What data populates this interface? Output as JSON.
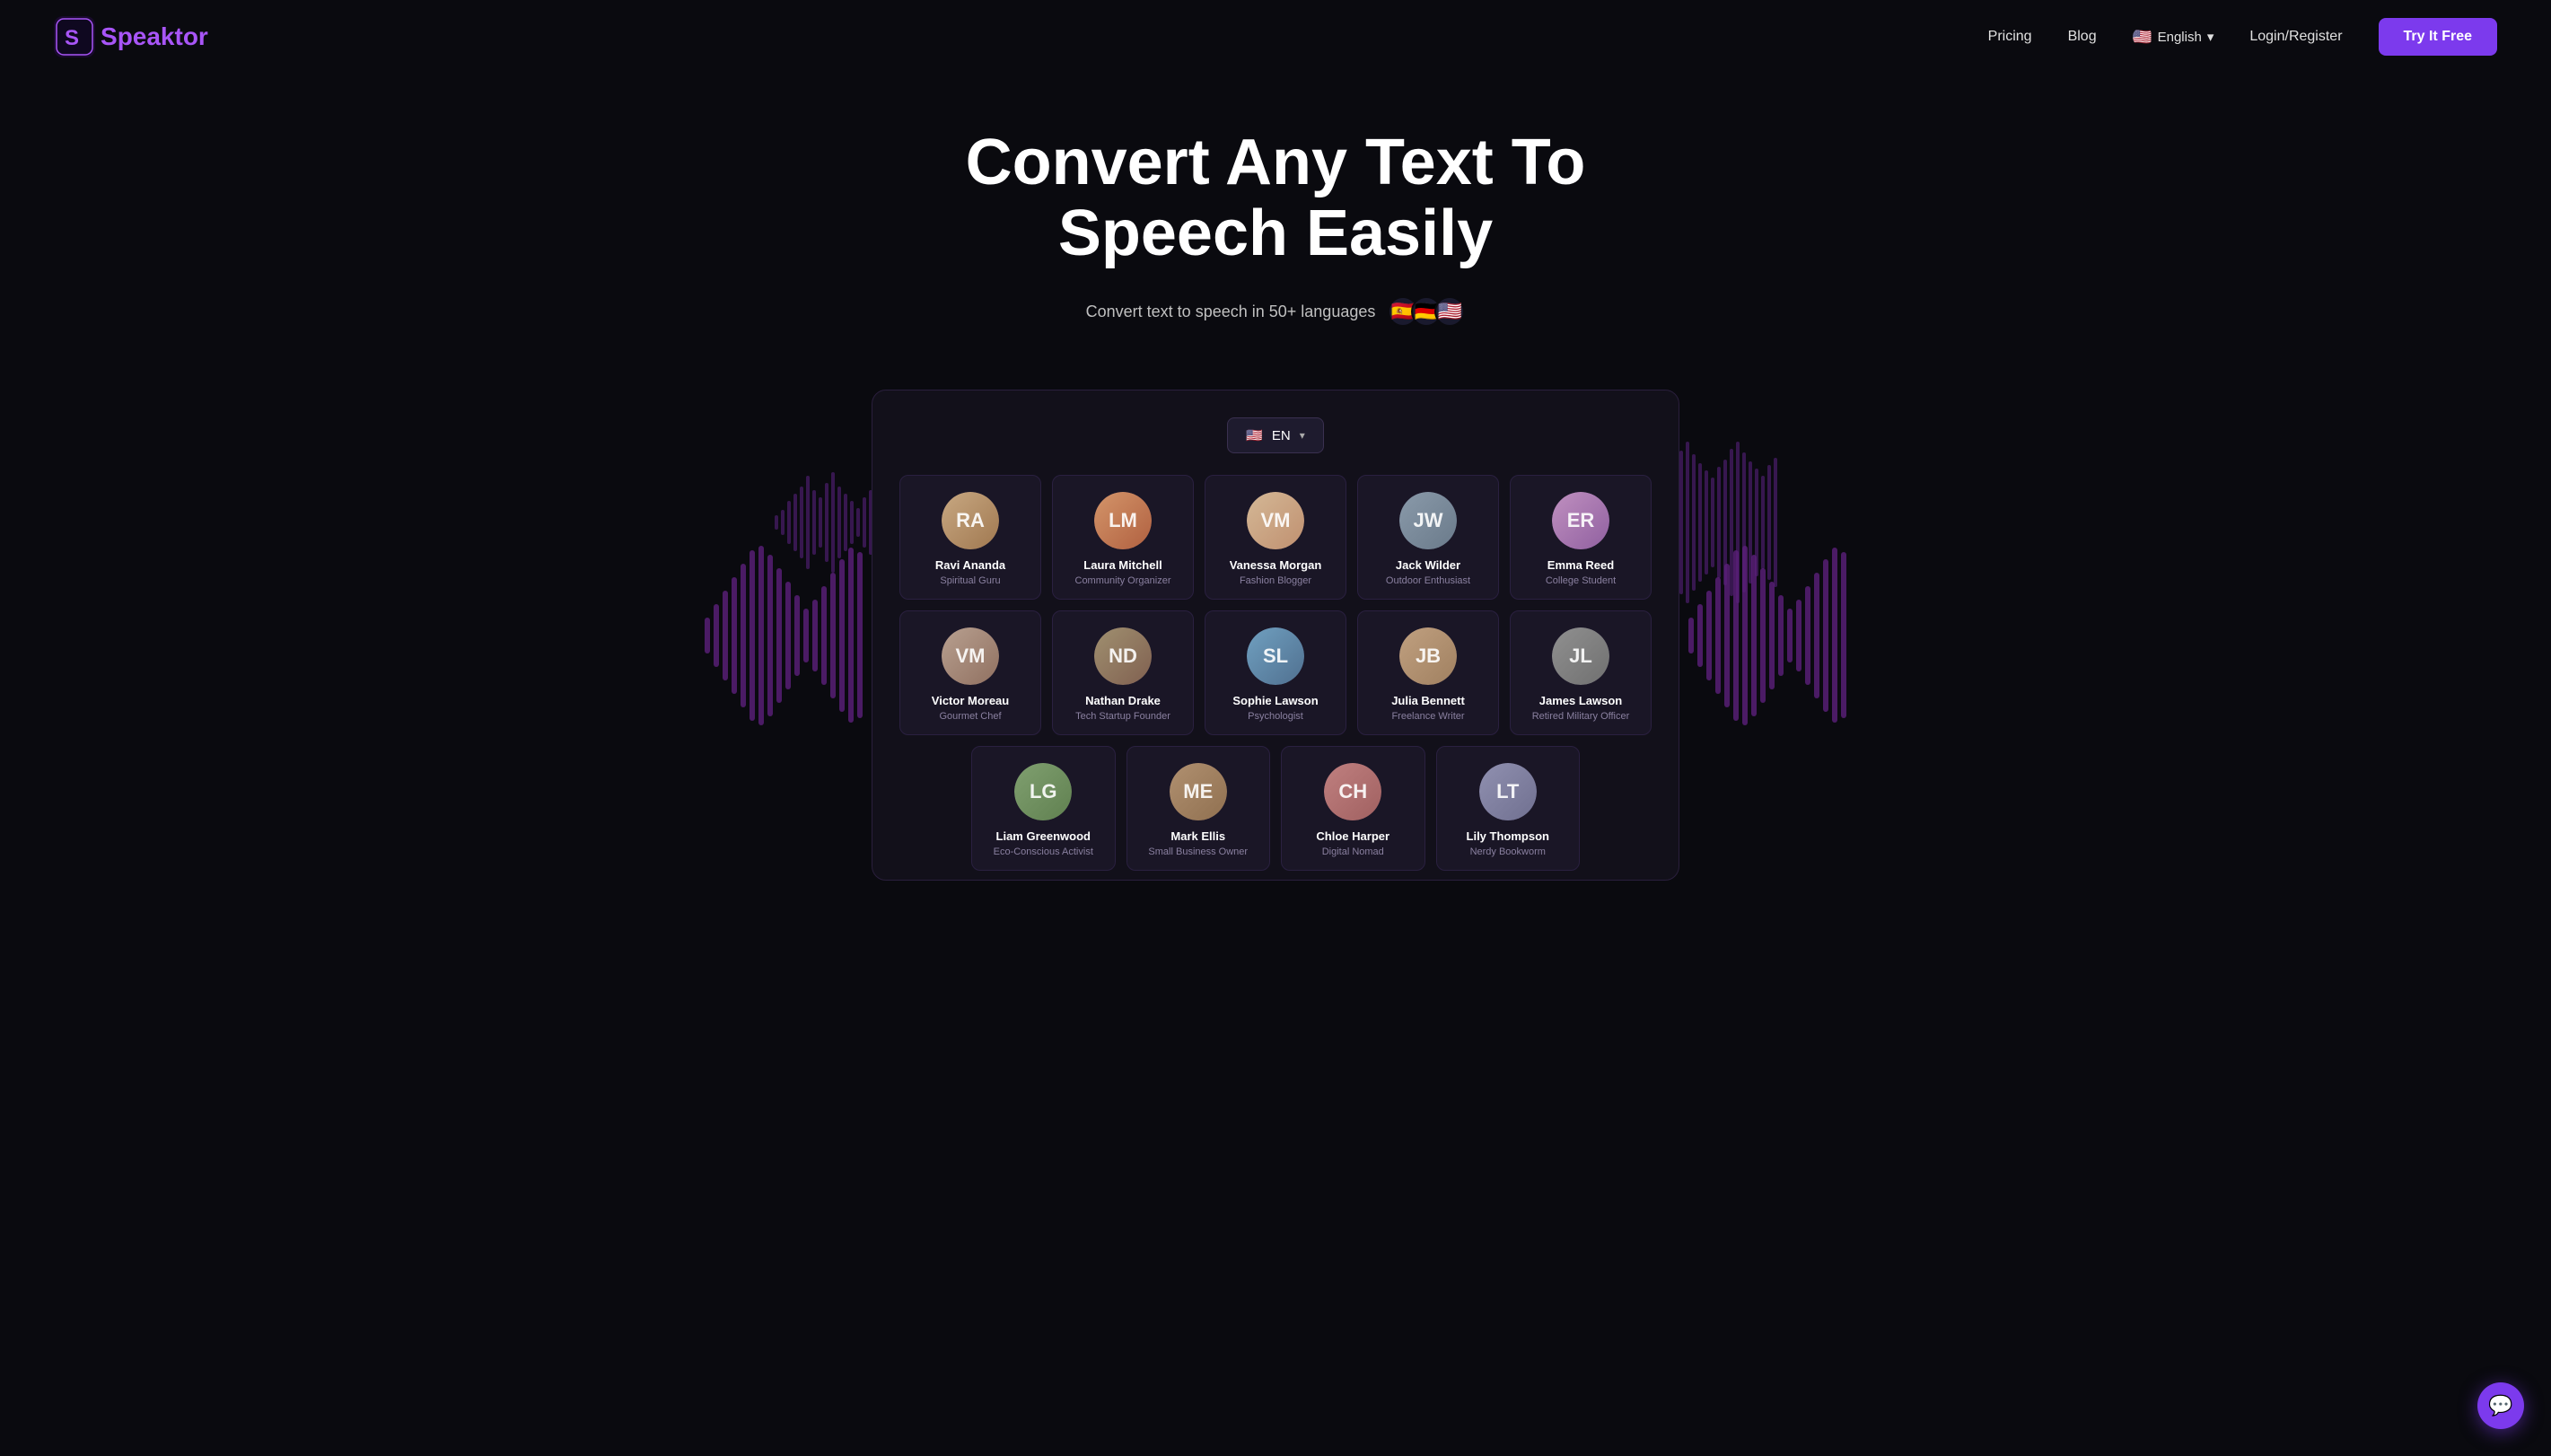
{
  "nav": {
    "logo_text": "Speaktor",
    "logo_s": "S",
    "links": [
      {
        "label": "Pricing",
        "id": "pricing"
      },
      {
        "label": "Blog",
        "id": "blog"
      }
    ],
    "lang": "English",
    "lang_flag": "🇺🇸",
    "login_label": "Login/Register",
    "try_btn_label": "Try It Free"
  },
  "hero": {
    "title": "Convert Any Text To Speech Easily",
    "subtitle": "Convert text to speech in 50+ languages",
    "flags": [
      "🇪🇸",
      "🇩🇪",
      "🇺🇸"
    ]
  },
  "app": {
    "lang_selector": {
      "flag": "🇺🇸",
      "code": "EN"
    },
    "voices_row1": [
      {
        "name": "Ravi Ananda",
        "role": "Spiritual Guru",
        "initials": "RA",
        "class": "av-ravi"
      },
      {
        "name": "Laura Mitchell",
        "role": "Community Organizer",
        "initials": "LM",
        "class": "av-laura"
      },
      {
        "name": "Vanessa Morgan",
        "role": "Fashion Blogger",
        "initials": "VM",
        "class": "av-vanessa"
      },
      {
        "name": "Jack Wilder",
        "role": "Outdoor Enthusiast",
        "initials": "JW",
        "class": "av-jack"
      },
      {
        "name": "Emma Reed",
        "role": "College Student",
        "initials": "ER",
        "class": "av-emma"
      }
    ],
    "voices_row2": [
      {
        "name": "Victor Moreau",
        "role": "Gourmet Chef",
        "initials": "VM",
        "class": "av-victor"
      },
      {
        "name": "Nathan Drake",
        "role": "Tech Startup Founder",
        "initials": "ND",
        "class": "av-nathan"
      },
      {
        "name": "Sophie Lawson",
        "role": "Psychologist",
        "initials": "SL",
        "class": "av-sophie"
      },
      {
        "name": "Julia Bennett",
        "role": "Freelance Writer",
        "initials": "JB",
        "class": "av-julia"
      },
      {
        "name": "James Lawson",
        "role": "Retired Military Officer",
        "initials": "JL",
        "class": "av-james"
      }
    ],
    "voices_row3": [
      {
        "name": "Liam Greenwood",
        "role": "Eco-Conscious Activist",
        "initials": "LG",
        "class": "av-liam"
      },
      {
        "name": "Mark Ellis",
        "role": "Small Business Owner",
        "initials": "ME",
        "class": "av-mark"
      },
      {
        "name": "Chloe Harper",
        "role": "Digital Nomad",
        "initials": "CH",
        "class": "av-chloe"
      },
      {
        "name": "Lily Thompson",
        "role": "Nerdy Bookworm",
        "initials": "LT",
        "class": "av-lily"
      }
    ]
  },
  "chat": {
    "icon": "💬"
  }
}
